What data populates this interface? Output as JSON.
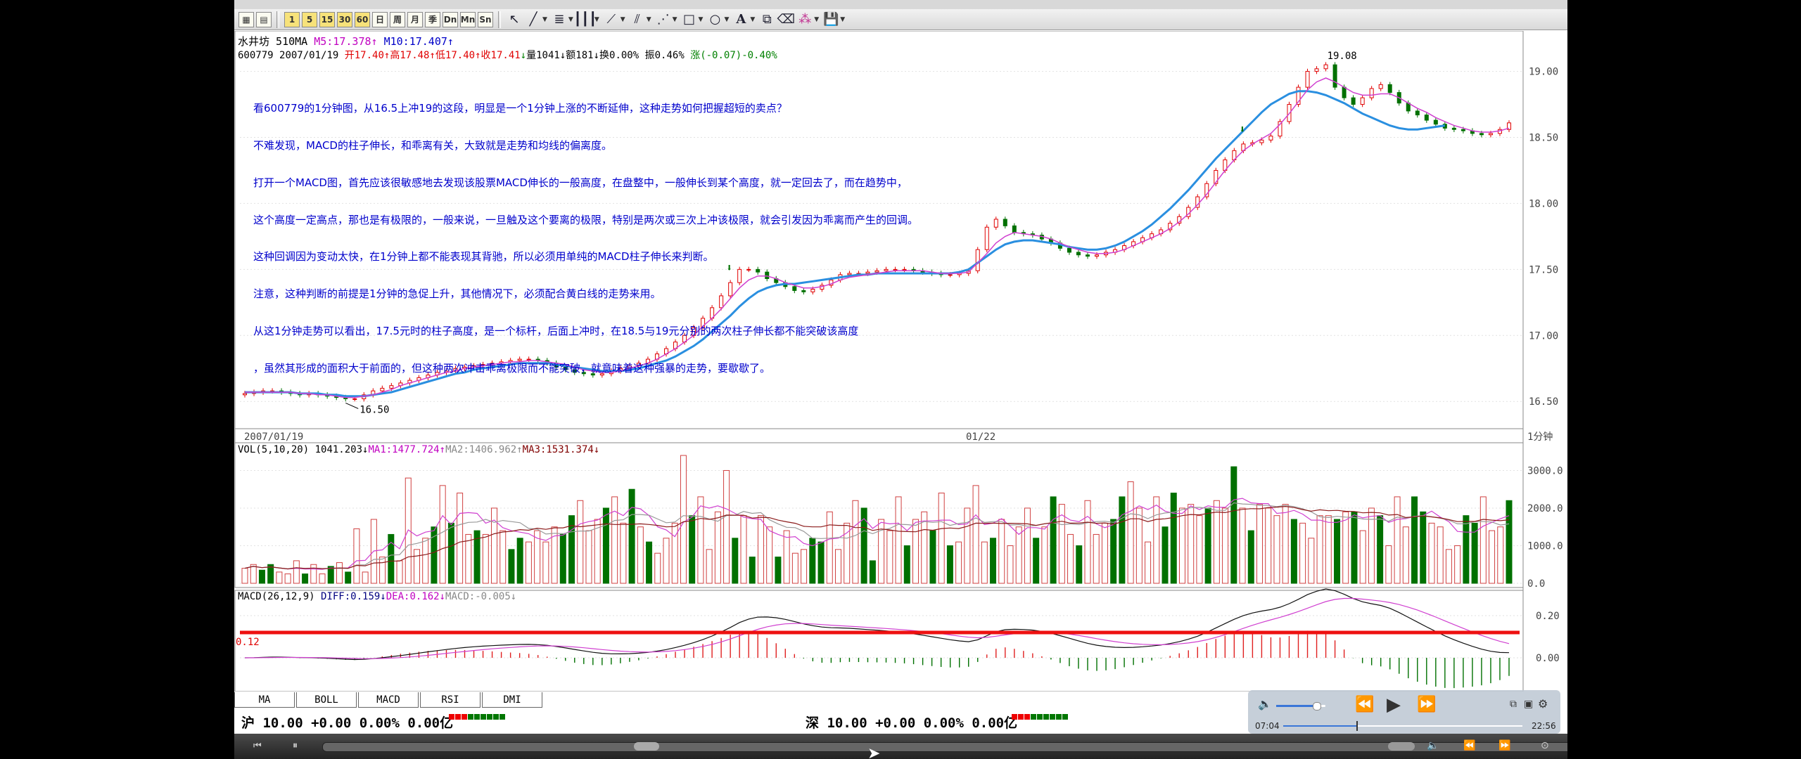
{
  "toolbar": {
    "buttons": [
      "1",
      "5",
      "15",
      "30",
      "60",
      "日",
      "周",
      "月",
      "季",
      "Dn",
      "Mn",
      "Sn"
    ],
    "tools": [
      "cursor-icon",
      "line-tool-icon",
      "fib-icon",
      "parallel-lines-icon",
      "fan-icon",
      "channel-icon",
      "pitchfork-icon",
      "rectangle-icon",
      "ellipse-icon",
      "text-icon",
      "copy-icon",
      "eraser-icon",
      "palette-icon",
      "save-icon"
    ]
  },
  "price_header": {
    "name": "水井坊",
    "period": "510MA",
    "ma5_label": "M5:17.378",
    "ma10_label": "M10:17.407",
    "code": "600779",
    "date": "2007/01/19",
    "open": "开17.40",
    "high": "高17.48",
    "low": "低17.40",
    "close": "收17.41",
    "volume": "量1041",
    "amount": "额181",
    "turnover": "换0.00%",
    "amplitude": "振0.46%",
    "change": "涨(-0.07)-0.40%"
  },
  "annotation": [
    "看600779的1分钟图，从16.5上冲19的这段，明显是一个1分钟上涨的不断延伸，这种走势如何把握超短的卖点？",
    "不难发现，MACD的柱子伸长，和乖离有关，大致就是走势和均线的偏离度。",
    "打开一个MACD图，首先应该很敏感地去发现该股票MACD伸长的一般高度，在盘整中，一般伸长到某个高度，就一定回去了，而在趋势中，",
    "这个高度一定高点，那也是有极限的，一般来说，一旦触及这个要离的极限，特别是两次或三次上冲该极限，就会引发因为乖离而产生的回调。",
    "这种回调因为变动太快，在1分钟上都不能表现其背驰，所以必须用单纯的MACD柱子伸长来判断。",
    "注意，这种判断的前提是1分钟的急促上升，其他情况下，必须配合黄白线的走势来用。",
    "从这1分钟走势可以看出，17.5元时的柱子高度，是一个标杆，后面上冲时，在18.5与19元分别的两次柱子伸长都不能突破该高度",
    "，虽然其形成的面积大于前面的，但这种两次冲击乖离极限而不能突破，就意味着这种强暴的走势，要歇歇了。"
  ],
  "chart_data": {
    "type": "candlestick",
    "x_labels": [
      "2007/01/19",
      "01/22"
    ],
    "period_label": "1分钟",
    "ylim": [
      16.4,
      19.2
    ],
    "yticks": [
      "19.00",
      "18.50",
      "18.00",
      "17.50",
      "17.00",
      "16.50"
    ],
    "high_label": "19.08",
    "low_label": "16.50",
    "close": [
      16.56,
      16.57,
      16.58,
      16.58,
      16.57,
      16.56,
      16.55,
      16.56,
      16.55,
      16.54,
      16.53,
      16.52,
      16.52,
      16.55,
      16.58,
      16.6,
      16.62,
      16.64,
      16.66,
      16.68,
      16.7,
      16.72,
      16.73,
      16.75,
      16.76,
      16.77,
      16.78,
      16.79,
      16.8,
      16.81,
      16.82,
      16.82,
      16.81,
      16.79,
      16.76,
      16.74,
      16.72,
      16.71,
      16.7,
      16.71,
      16.73,
      16.75,
      16.77,
      16.79,
      16.82,
      16.86,
      16.9,
      16.95,
      17.0,
      17.06,
      17.13,
      17.21,
      17.3,
      17.4,
      17.5,
      17.5,
      17.48,
      17.43,
      17.4,
      17.37,
      17.34,
      17.33,
      17.35,
      17.38,
      17.42,
      17.46,
      17.47,
      17.47,
      17.48,
      17.49,
      17.5,
      17.5,
      17.5,
      17.49,
      17.48,
      17.47,
      17.46,
      17.46,
      17.47,
      17.49,
      17.65,
      17.82,
      17.88,
      17.83,
      17.78,
      17.77,
      17.76,
      17.73,
      17.7,
      17.66,
      17.63,
      17.61,
      17.6,
      17.61,
      17.63,
      17.65,
      17.68,
      17.71,
      17.74,
      17.77,
      17.8,
      17.85,
      17.9,
      17.97,
      18.05,
      18.15,
      18.25,
      18.33,
      18.4,
      18.45,
      18.46,
      18.48,
      18.51,
      18.62,
      18.75,
      18.88,
      19.0,
      19.02,
      19.05,
      18.88,
      18.8,
      18.75,
      18.8,
      18.87,
      18.9,
      18.84,
      18.76,
      18.7,
      18.67,
      18.63,
      18.6,
      18.57,
      18.56,
      18.55,
      18.53,
      18.52,
      18.53,
      18.56,
      18.61
    ],
    "ma5": [
      16.57,
      16.57,
      16.57,
      16.57,
      16.57,
      16.57,
      16.56,
      16.56,
      16.55,
      16.55,
      16.54,
      16.53,
      16.53,
      16.54,
      16.55,
      16.57,
      16.59,
      16.62,
      16.64,
      16.66,
      16.68,
      16.7,
      16.72,
      16.73,
      16.75,
      16.76,
      16.77,
      16.78,
      16.79,
      16.8,
      16.8,
      16.81,
      16.81,
      16.8,
      16.79,
      16.78,
      16.76,
      16.74,
      16.73,
      16.72,
      16.72,
      16.73,
      16.75,
      16.77,
      16.79,
      16.82,
      16.86,
      16.9,
      16.95,
      17.0,
      17.07,
      17.13,
      17.2,
      17.28,
      17.36,
      17.42,
      17.45,
      17.45,
      17.43,
      17.4,
      17.38,
      17.36,
      17.36,
      17.37,
      17.39,
      17.42,
      17.44,
      17.45,
      17.46,
      17.47,
      17.48,
      17.49,
      17.49,
      17.49,
      17.49,
      17.48,
      17.47,
      17.47,
      17.47,
      17.48,
      17.55,
      17.62,
      17.7,
      17.75,
      17.78,
      17.77,
      17.76,
      17.75,
      17.73,
      17.7,
      17.67,
      17.65,
      17.63,
      17.62,
      17.62,
      17.63,
      17.65,
      17.68,
      17.71,
      17.74,
      17.77,
      17.81,
      17.86,
      17.92,
      17.99,
      18.07,
      18.16,
      18.25,
      18.33,
      18.4,
      18.45,
      18.49,
      18.53,
      18.6,
      18.68,
      18.77,
      18.86,
      18.92,
      18.95,
      18.92,
      18.88,
      18.84,
      18.82,
      18.82,
      18.83,
      18.83,
      18.8,
      18.76,
      18.72,
      18.69,
      18.65,
      18.62,
      18.59,
      18.57,
      18.55,
      18.54,
      18.54,
      18.55,
      18.57
    ],
    "ma10": [
      16.57,
      16.57,
      16.57,
      16.57,
      16.57,
      16.57,
      16.56,
      16.56,
      16.56,
      16.55,
      16.55,
      16.54,
      16.54,
      16.54,
      16.55,
      16.56,
      16.57,
      16.59,
      16.61,
      16.63,
      16.65,
      16.67,
      16.69,
      16.71,
      16.72,
      16.74,
      16.75,
      16.76,
      16.77,
      16.78,
      16.79,
      16.79,
      16.79,
      16.79,
      16.78,
      16.77,
      16.76,
      16.75,
      16.74,
      16.73,
      16.73,
      16.73,
      16.74,
      16.75,
      16.77,
      16.79,
      16.81,
      16.84,
      16.88,
      16.92,
      16.97,
      17.03,
      17.09,
      17.15,
      17.22,
      17.28,
      17.33,
      17.36,
      17.38,
      17.39,
      17.39,
      17.4,
      17.41,
      17.42,
      17.43,
      17.44,
      17.45,
      17.46,
      17.46,
      17.47,
      17.47,
      17.47,
      17.47,
      17.47,
      17.47,
      17.47,
      17.47,
      17.47,
      17.48,
      17.5,
      17.55,
      17.6,
      17.65,
      17.69,
      17.71,
      17.72,
      17.72,
      17.71,
      17.7,
      17.69,
      17.67,
      17.66,
      17.65,
      17.65,
      17.66,
      17.68,
      17.71,
      17.75,
      17.79,
      17.84,
      17.9,
      17.96,
      18.03,
      18.1,
      18.18,
      18.26,
      18.34,
      18.41,
      18.48,
      18.55,
      18.62,
      18.69,
      18.75,
      18.79,
      18.83,
      18.85,
      18.85,
      18.84,
      18.82,
      18.79,
      18.76,
      18.72,
      18.68,
      18.65,
      18.62,
      18.59,
      18.57,
      18.56,
      18.56,
      18.57,
      18.58,
      18.59
    ],
    "volume_header": {
      "label": "VOL(5,10,20)",
      "vol": "1041.203",
      "ma1": "MA1:1477.724",
      "ma2": "MA2:1406.962",
      "ma3": "MA3:1531.374"
    },
    "volume_yticks": [
      "3000.0",
      "2000.0",
      "1000.0",
      "0.0"
    ],
    "volume": [
      400,
      500,
      350,
      500,
      300,
      250,
      600,
      250,
      500,
      250,
      450,
      550,
      300,
      1450,
      300,
      1700,
      700,
      1300,
      600,
      2800,
      900,
      1200,
      1500,
      2600,
      1600,
      2400,
      1300,
      1400,
      1300,
      2000,
      1400,
      900,
      1200,
      1100,
      1400,
      1100,
      1500,
      1300,
      1800,
      2200,
      1400,
      1700,
      2000,
      2300,
      1600,
      2500,
      1500,
      1100,
      800,
      1200,
      1600,
      3400,
      1800,
      2300,
      900,
      1900,
      3000,
      1200,
      1800,
      700,
      1800,
      1500,
      700,
      1400,
      800,
      900,
      1200,
      1100,
      1900,
      900,
      1600,
      2200,
      2000,
      600,
      1700,
      1400,
      2300,
      1000,
      1700,
      1900,
      1400,
      2400,
      1000,
      1100,
      2000,
      2600,
      1100,
      1200,
      1700,
      1000,
      1500,
      2000,
      1200,
      1500,
      2300,
      2100,
      1300,
      1000,
      2200,
      1300,
      1600,
      1700,
      2300,
      2700,
      2000,
      1100,
      2300,
      1500,
      2400,
      2000,
      2100,
      1800,
      2000,
      2200,
      2000,
      3100,
      2000,
      1400,
      2100,
      2000,
      1800,
      2100,
      1700,
      1600,
      1200,
      1800,
      1800,
      1700,
      1900,
      1900,
      1400,
      2000,
      1800,
      1000,
      2300,
      1500,
      2300,
      1900,
      1600,
      1500,
      900,
      1000,
      1800,
      1600,
      2300,
      1400,
      1500,
      2200
    ],
    "macd_header": {
      "label": "MACD(26,12,9)",
      "diff": "DIFF:0.159",
      "dea": "DEA:0.162",
      "macd": "MACD:-0.005"
    },
    "macd_yticks": [
      "0.20",
      "0.00"
    ],
    "macd_ylim": [
      -0.16,
      0.32
    ],
    "macd_line_value": "0.12"
  },
  "tabs": [
    "MA",
    "BOLL",
    "MACD",
    "RSI",
    "DMI"
  ],
  "market": {
    "sh": "沪 10.00 +0.00 0.00% 0.00亿",
    "sz": "深 10.00 +0.00 0.00% 0.00亿"
  },
  "player": {
    "current_time": "07:04",
    "total_time": "22:56",
    "progress": 0.307
  }
}
